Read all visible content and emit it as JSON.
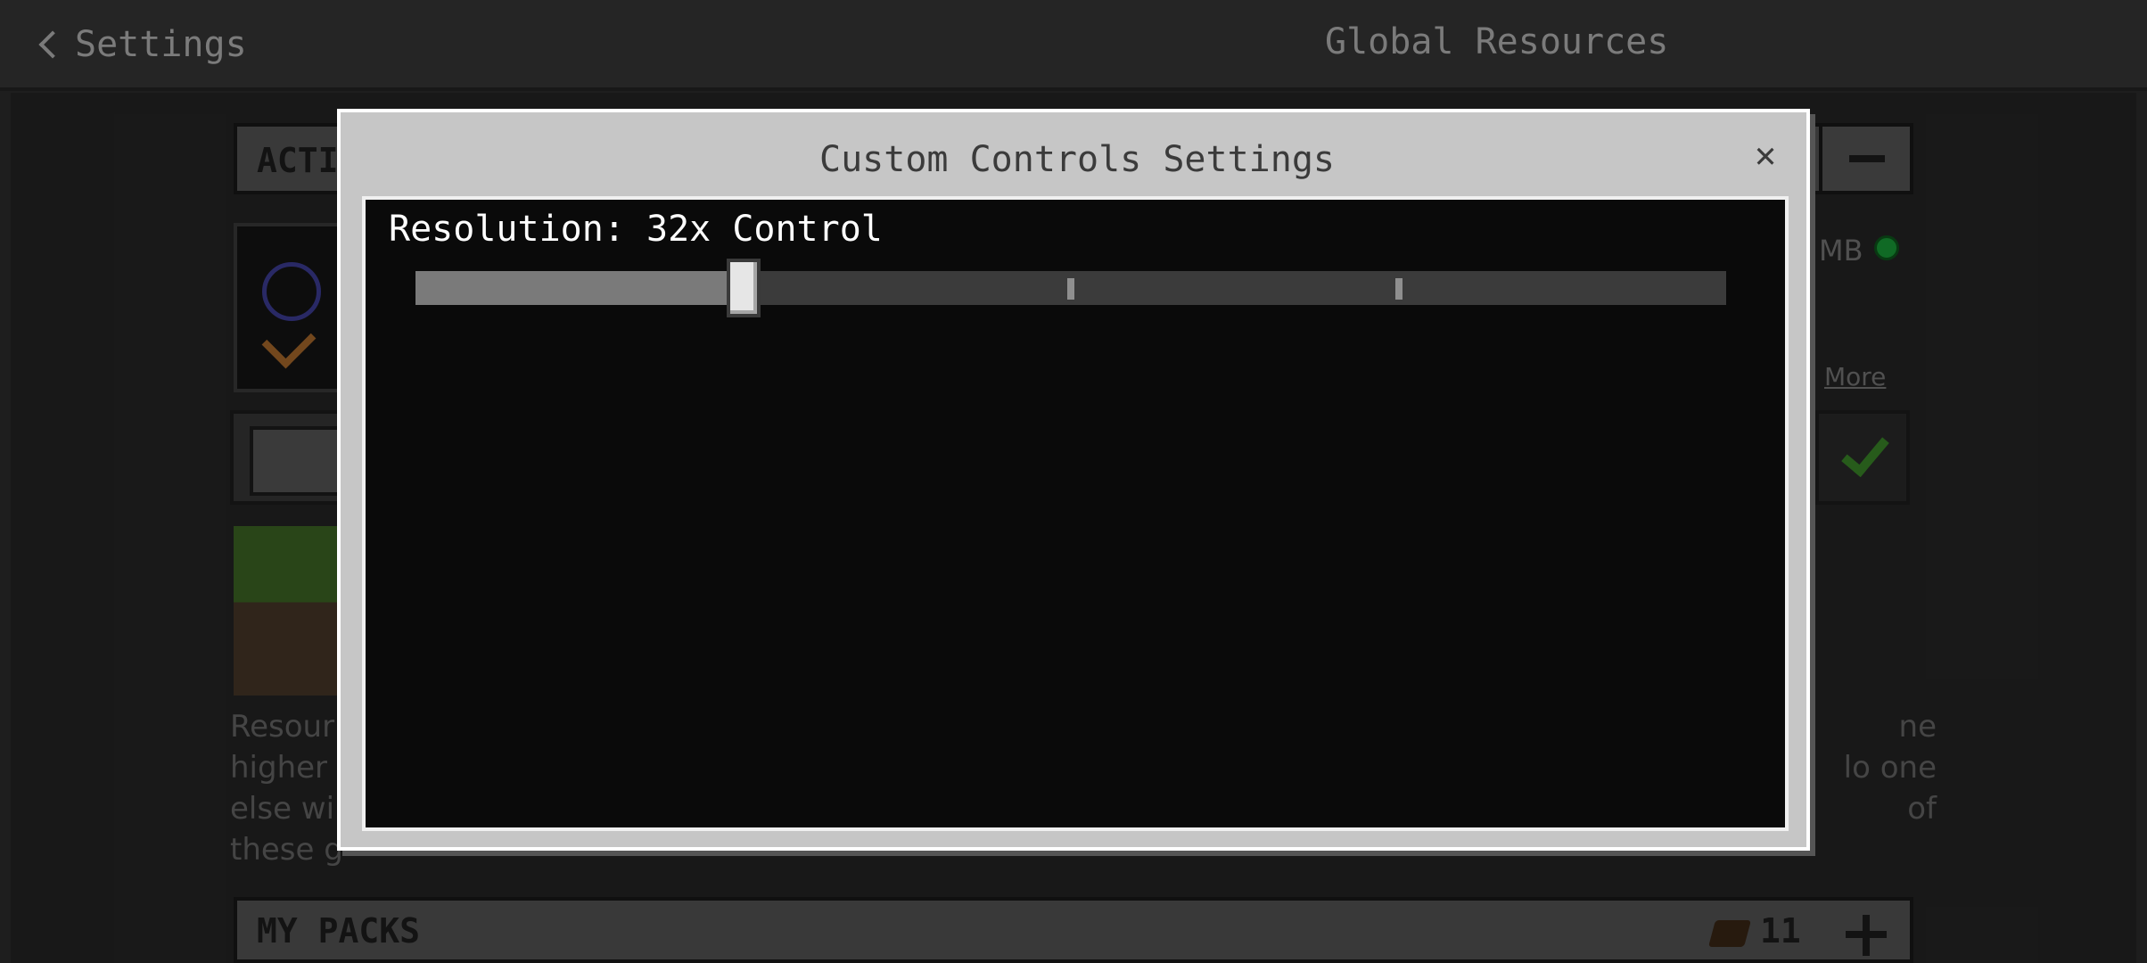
{
  "topbar": {
    "back_label": "Settings",
    "title": "Global Resources"
  },
  "background": {
    "active_header": "ACTI",
    "size_text": "MB",
    "more_link": "More",
    "description_left": "Resour\nhigher\nelse wi\nthese g",
    "description_right": "ne\nlo one\nof",
    "my_packs": {
      "label": "MY PACKS",
      "count": "11"
    }
  },
  "modal": {
    "title": "Custom Controls Settings",
    "close_icon": "close-icon",
    "resolution_label": "Resolution: 32x Control",
    "slider": {
      "value_fraction": 0.25,
      "ticks": [
        0.25,
        0.5,
        0.75
      ]
    }
  }
}
